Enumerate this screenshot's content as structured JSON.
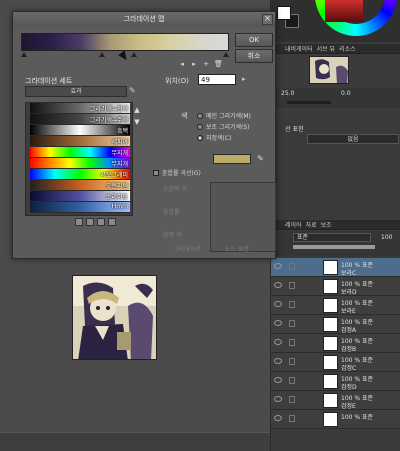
{
  "dialog": {
    "title": "그라데이션 맵",
    "close_glyph": "×",
    "ok_label": "OK",
    "cancel_label": "취소",
    "gradient_colors": [
      "#1f1531",
      "#2b1f4a",
      "#4a3a66",
      "#a89a74",
      "#c9bd86",
      "#d8d0a0",
      "#d9d5c8",
      "#d8d8d8"
    ],
    "stop_nav": {
      "prev_glyph": "◂",
      "next_glyph": "▸",
      "add_glyph": "+",
      "delete_glyph": "🗑"
    },
    "set_label": "그라데이션 세트",
    "set_value": "효과",
    "set_menu_glyph": "✎",
    "presets": [
      {
        "label": "그라기색→청색",
        "colors": [
          "#111111",
          "#6a6a6a",
          "#f0f0f0"
        ]
      },
      {
        "label": "그라기색→주색",
        "colors": [
          "#111111",
          "#444444",
          "#d0d0d0"
        ]
      },
      {
        "label": "흑백",
        "colors": [
          "#000000",
          "#ffffff",
          "#000000"
        ]
      },
      {
        "label": "세피아",
        "colors": [
          "#2b1a0c",
          "#a06a3a",
          "#f0d0a0"
        ]
      },
      {
        "label": "무지개",
        "colors": [
          "#ff0000",
          "#ffff00",
          "#00ff00",
          "#00ffff",
          "#0000ff",
          "#ff00ff"
        ]
      },
      {
        "label": "무지개",
        "colors": [
          "#ff0000",
          "#ff8800",
          "#ffff00",
          "#00ff00",
          "#0088ff",
          "#8800ff"
        ]
      },
      {
        "label": "서모그래피",
        "colors": [
          "#0000ff",
          "#00ffff",
          "#00ff00",
          "#ffff00",
          "#ff0000"
        ]
      },
      {
        "label": "오렌지템",
        "colors": [
          "#202020",
          "#c86020",
          "#ffd080"
        ]
      },
      {
        "label": "소리이토",
        "colors": [
          "#0a0a30",
          "#5050a0",
          "#ffffff"
        ]
      },
      {
        "label": "Hmm",
        "colors": [
          "#102040",
          "#3060a0",
          "#a0c0ff"
        ]
      }
    ],
    "list_up_glyph": "▲",
    "list_down_glyph": "▼",
    "position_label": "위치(O)",
    "position_value": "49",
    "position_arrow": "▸",
    "color_label": "색",
    "color_options": [
      "메인 그리기색(M)",
      "보조 그리기색(S)",
      "지정색(C)"
    ],
    "selected_color_option": 2,
    "color_value": "#b8ad68",
    "eyedropper_glyph": "✎",
    "mix_label": "혼합률 곡선(G)",
    "faint_labels": [
      "오른쪽 색",
      "혼합률",
      "왼쪽 색",
      "그라데이션",
      "왼쪽 색",
      "노드 보간"
    ]
  },
  "nav_panel": {
    "tabs": [
      "내비게이터",
      "서브 뷰",
      "리소스"
    ],
    "zoom": "25.0",
    "angle": "0.0"
  },
  "prop_panel": {
    "title": "선 표현",
    "select": "없음"
  },
  "layer_panel": {
    "tabs": [
      "레이어",
      "자료",
      "보조"
    ],
    "blend_mode": "표준",
    "opacity": "100",
    "opacity_fraction": 1.0,
    "layers": [
      {
        "mode": "100 % 표준",
        "name": "보라C",
        "selected": true
      },
      {
        "mode": "100 % 표준",
        "name": "보라D",
        "selected": false
      },
      {
        "mode": "100 % 표준",
        "name": "보라E",
        "selected": false
      },
      {
        "mode": "100 % 표준",
        "name": "검정A",
        "selected": false
      },
      {
        "mode": "100 % 표준",
        "name": "검정B",
        "selected": false
      },
      {
        "mode": "100 % 표준",
        "name": "검정C",
        "selected": false
      },
      {
        "mode": "100 % 표준",
        "name": "검정D",
        "selected": false
      },
      {
        "mode": "100 % 표준",
        "name": "검정E",
        "selected": false
      },
      {
        "mode": "100 % 표준",
        "name": "",
        "selected": false
      }
    ]
  }
}
